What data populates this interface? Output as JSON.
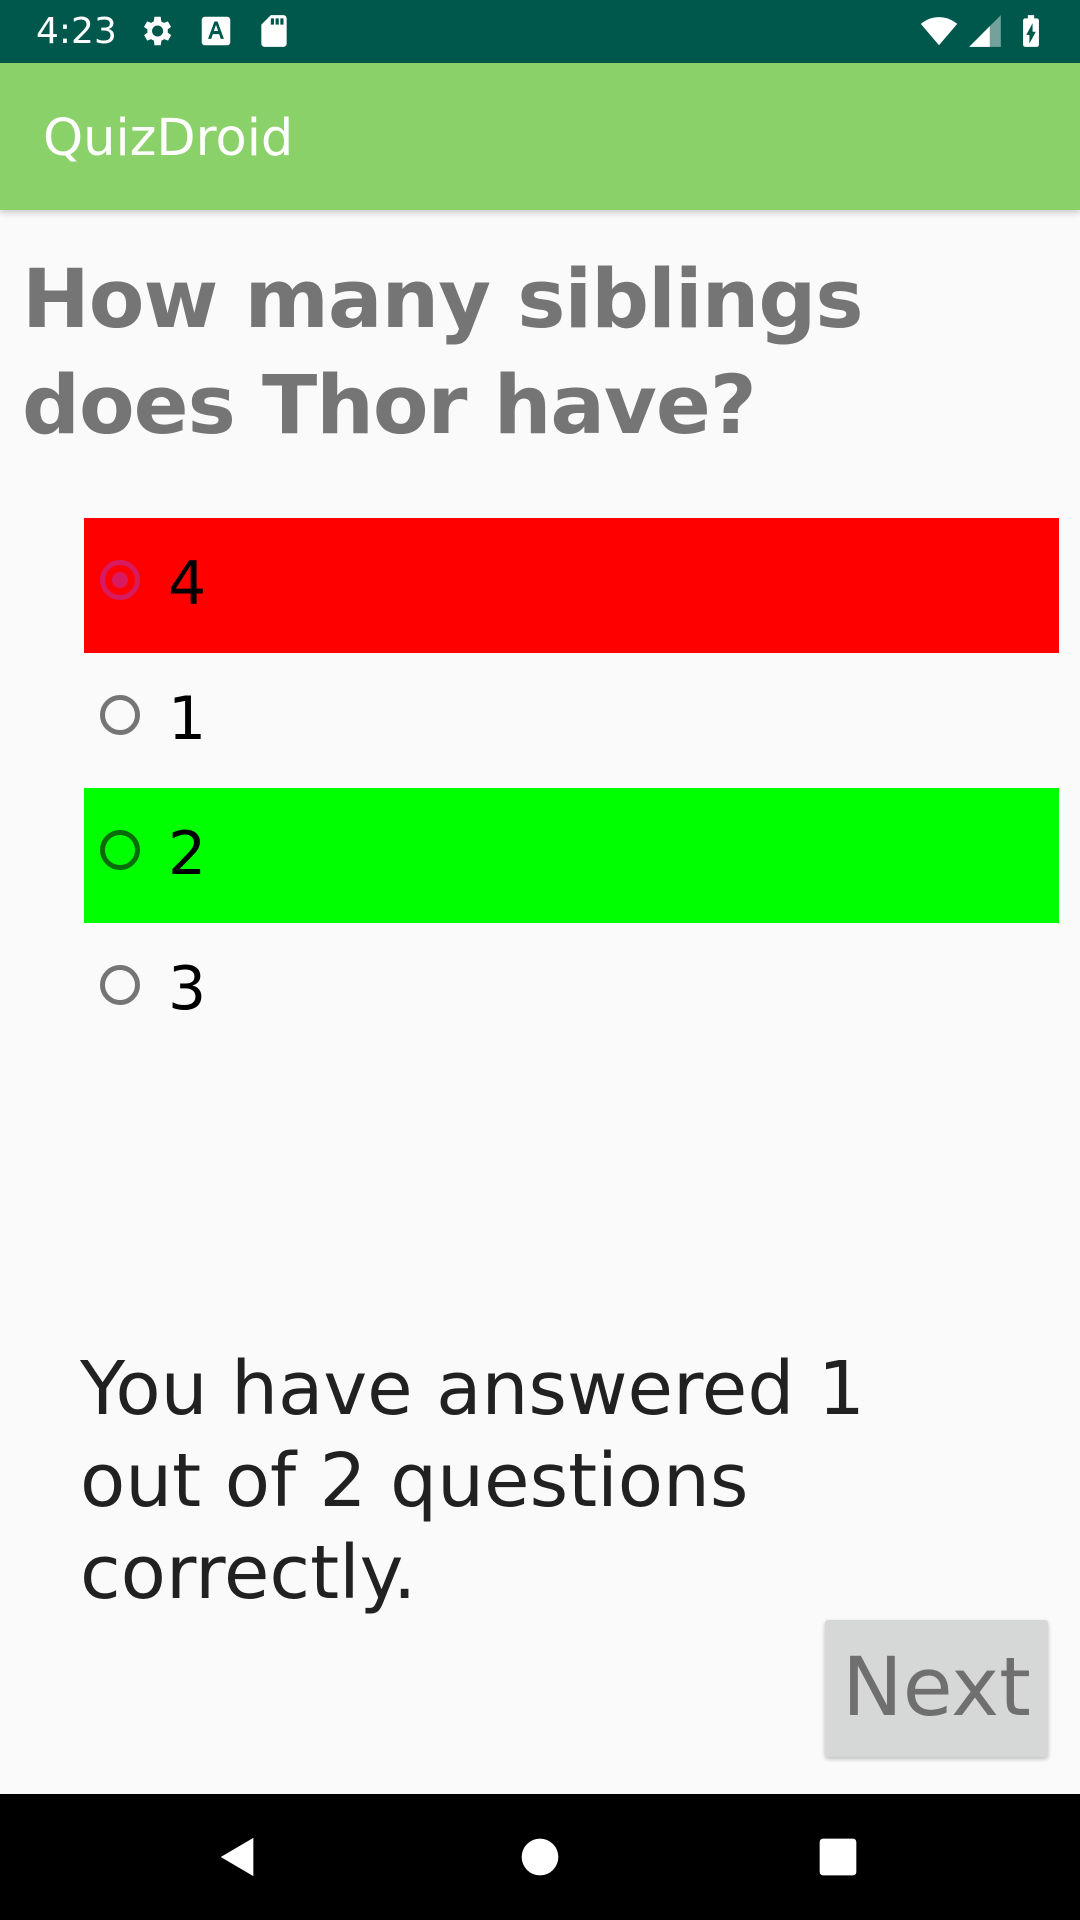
{
  "status_bar": {
    "time": "4:23",
    "icons": [
      "settings-icon",
      "font-download-icon",
      "sd-card-icon",
      "wifi-icon",
      "cell-signal-icon",
      "battery-charging-icon"
    ]
  },
  "app_bar": {
    "title": "QuizDroid"
  },
  "question": {
    "text": "How many siblings does Thor have?"
  },
  "options": [
    {
      "label": "4",
      "state": "selected-wrong",
      "color": "#ff0000"
    },
    {
      "label": "1",
      "state": "unselected"
    },
    {
      "label": "2",
      "state": "correct",
      "color": "#00ff00"
    },
    {
      "label": "3",
      "state": "unselected"
    }
  ],
  "score": {
    "text": "You have answered 1 out of 2 questions correctly."
  },
  "buttons": {
    "next_label": "Next"
  },
  "nav_bar": {
    "icons": [
      "back-icon",
      "home-icon",
      "recents-icon"
    ]
  },
  "colors": {
    "status_bar": "#00574b",
    "app_bar": "#8bd16a",
    "accent": "#d81b60",
    "wrong": "#ff0000",
    "correct": "#00ff00"
  }
}
